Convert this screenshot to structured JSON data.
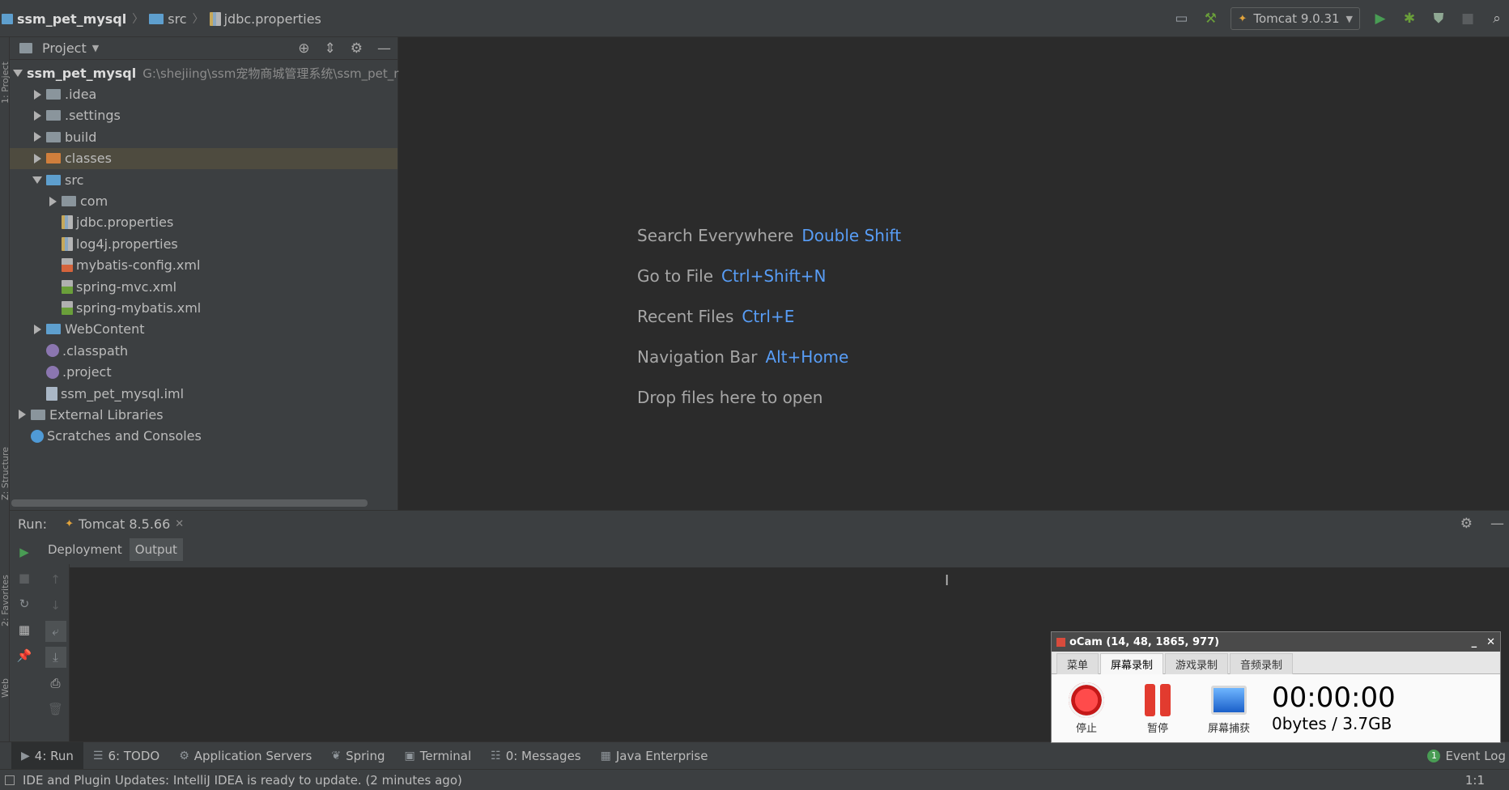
{
  "breadcrumb": {
    "project": "ssm_pet_mysql",
    "folder": "src",
    "file": "jdbc.properties"
  },
  "toolbar": {
    "run_config": "Tomcat 9.0.31"
  },
  "project_panel": {
    "title": "Project",
    "tree": [
      {
        "label": "ssm_pet_mysql",
        "path": "G:\\shejiing\\ssm宠物商城管理系统\\ssm_pet_r",
        "indent": 0,
        "arrow": "down",
        "icon": "module-icon",
        "bold": true
      },
      {
        "label": ".idea",
        "indent": 1,
        "arrow": "right",
        "icon": "folder-icon"
      },
      {
        "label": ".settings",
        "indent": 1,
        "arrow": "right",
        "icon": "folder-icon"
      },
      {
        "label": "build",
        "indent": 1,
        "arrow": "right",
        "icon": "folder-icon"
      },
      {
        "label": "classes",
        "indent": 1,
        "arrow": "right",
        "icon": "excluded-folder-icon",
        "selected": true
      },
      {
        "label": "src",
        "indent": 1,
        "arrow": "down",
        "icon": "source-folder-icon"
      },
      {
        "label": "com",
        "indent": 2,
        "arrow": "right",
        "icon": "package-icon"
      },
      {
        "label": "jdbc.properties",
        "indent": 2,
        "arrow": "",
        "icon": "properties-file-icon"
      },
      {
        "label": "log4j.properties",
        "indent": 2,
        "arrow": "",
        "icon": "properties-file-icon"
      },
      {
        "label": "mybatis-config.xml",
        "indent": 2,
        "arrow": "",
        "icon": "xml-file-icon"
      },
      {
        "label": "spring-mvc.xml",
        "indent": 2,
        "arrow": "",
        "icon": "spring-xml-icon"
      },
      {
        "label": "spring-mybatis.xml",
        "indent": 2,
        "arrow": "",
        "icon": "spring-xml-icon"
      },
      {
        "label": "WebContent",
        "indent": 1,
        "arrow": "right",
        "icon": "web-folder-icon"
      },
      {
        "label": ".classpath",
        "indent": 1,
        "arrow": "",
        "icon": "classpath-file-icon"
      },
      {
        "label": ".project",
        "indent": 1,
        "arrow": "",
        "icon": "project-file-icon"
      },
      {
        "label": "ssm_pet_mysql.iml",
        "indent": 1,
        "arrow": "",
        "icon": "iml-file-icon"
      },
      {
        "label": "External Libraries",
        "indent": 0,
        "arrow": "right",
        "icon": "libraries-icon"
      },
      {
        "label": "Scratches and Consoles",
        "indent": 0,
        "arrow": "",
        "icon": "scratches-icon"
      }
    ]
  },
  "editor": {
    "hints": [
      {
        "text": "Search Everywhere",
        "key": "Double Shift"
      },
      {
        "text": "Go to File",
        "key": "Ctrl+Shift+N"
      },
      {
        "text": "Recent Files",
        "key": "Ctrl+E"
      },
      {
        "text": "Navigation Bar",
        "key": "Alt+Home"
      },
      {
        "text": "Drop files here to open",
        "key": ""
      }
    ]
  },
  "run_panel": {
    "label": "Run:",
    "tab": "Tomcat 8.5.66",
    "subtabs": [
      "Deployment",
      "Output"
    ],
    "active_subtab": "Output"
  },
  "left_strip": {
    "project": "1: Project",
    "structure": "Z: Structure",
    "favorites": "2: Favorites",
    "web": "Web"
  },
  "tool_windows": [
    {
      "label": "4: Run",
      "icon": "run-icon",
      "active": true
    },
    {
      "label": "6: TODO",
      "icon": "todo-icon"
    },
    {
      "label": "Application Servers",
      "icon": "app-servers-icon"
    },
    {
      "label": "Spring",
      "icon": "spring-icon"
    },
    {
      "label": "Terminal",
      "icon": "terminal-icon"
    },
    {
      "label": "0: Messages",
      "icon": "messages-icon"
    },
    {
      "label": "Java Enterprise",
      "icon": "java-enterprise-icon"
    }
  ],
  "event_log": {
    "count": "1",
    "label": "Event Log"
  },
  "status_bar": {
    "message": "IDE and Plugin Updates: IntelliJ IDEA is ready to update. (2 minutes ago)",
    "position": "1:1"
  },
  "ocam": {
    "title": "oCam (14, 48, 1865, 977)",
    "tabs": [
      "菜单",
      "屏幕录制",
      "游戏录制",
      "音频录制"
    ],
    "active_tab": "屏幕录制",
    "stop_label": "停止",
    "pause_label": "暂停",
    "capture_label": "屏幕捕获",
    "timer": "00:00:00",
    "size": "0bytes / 3.7GB"
  }
}
